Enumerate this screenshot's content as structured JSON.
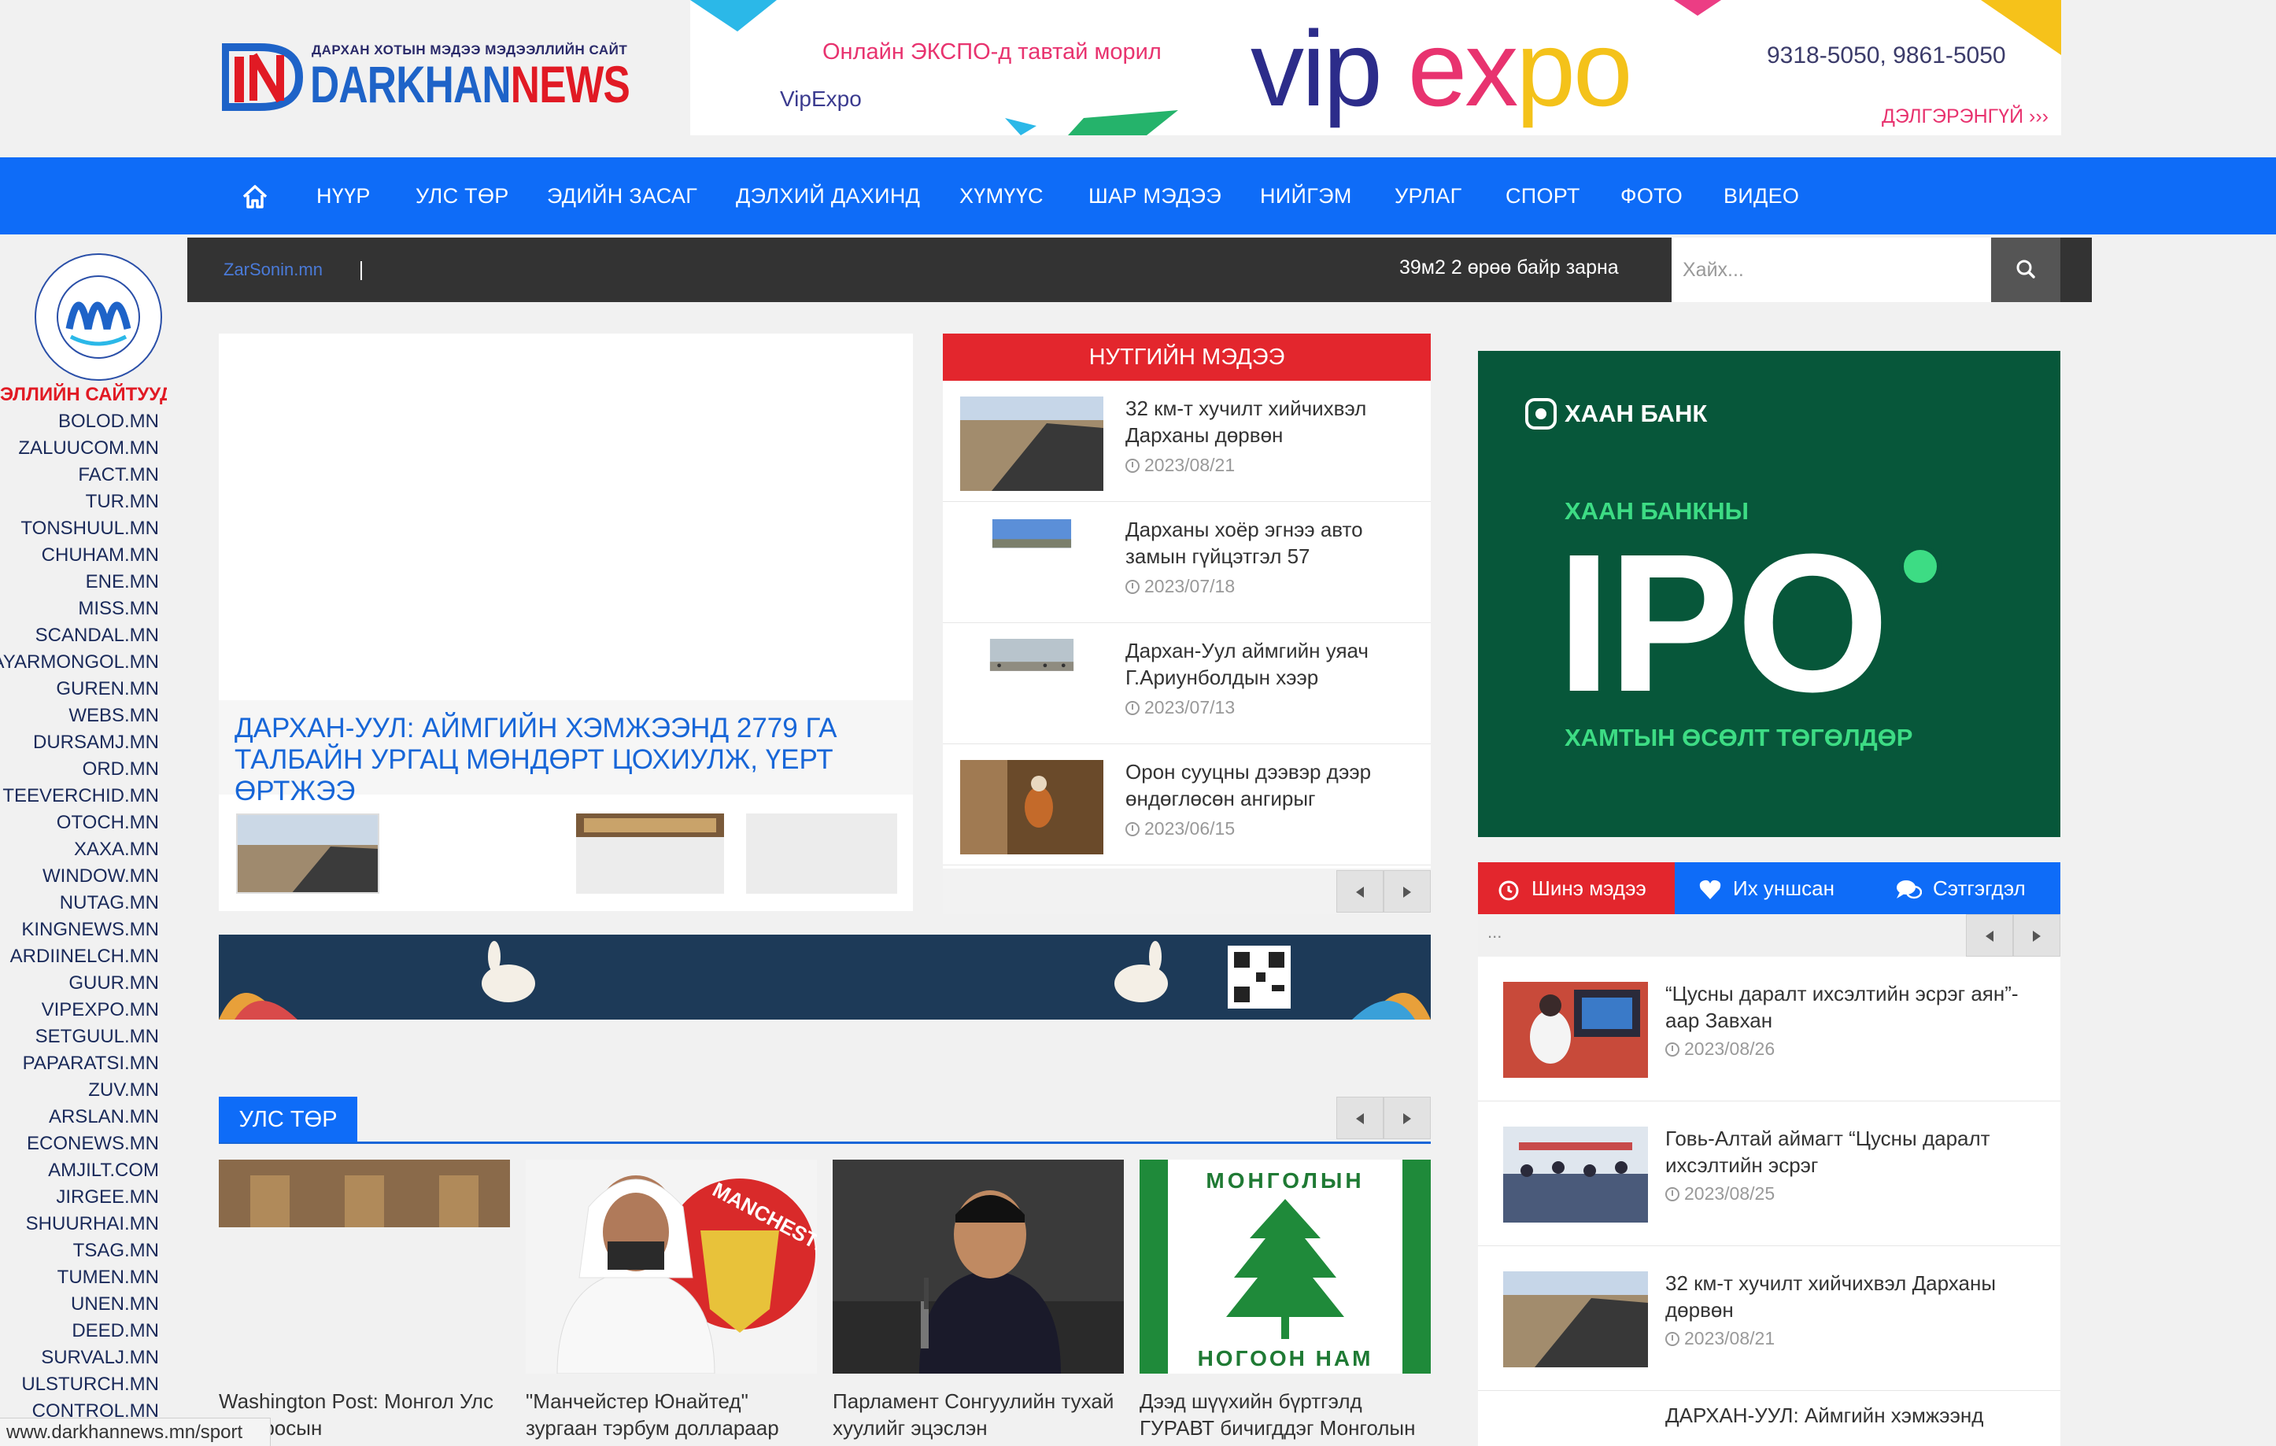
{
  "logo": {
    "tagline": "ДАРХАН ХОТЫН МЭДЭЭ МЭДЭЭЛЛИЙН САЙТ",
    "name_part1": "DARKHAN",
    "name_part2": "NEWS"
  },
  "top_ad": {
    "headline": "Онлайн ЭКСПО-д тавтай морил",
    "brand": "VipExpo",
    "logo_vip": "vip",
    "logo_ex": "ex",
    "logo_po": "po",
    "phones": "9318-5050, 9861-5050",
    "more": "ДЭЛГЭРЭНГҮЙ ›››"
  },
  "nav": {
    "items": [
      "НҮҮР",
      "УЛС ТӨР",
      "ЭДИЙН ЗАСАГ",
      "ДЭЛХИЙ ДАХИНД",
      "ХҮМҮҮС",
      "ШАР МЭДЭЭ",
      "НИЙГЭМ",
      "УРЛАГ",
      "СПОРТ",
      "ФОТО",
      "ВИДЕО"
    ]
  },
  "sidebar": {
    "heading": "ЭЛЛИЙН САЙТУУД",
    "sites": [
      "BOLOD.MN",
      "ZALUUCOM.MN",
      "FACT.MN",
      "TUR.MN",
      "TONSHUUL.MN",
      "CHUHAM.MN",
      "ENE.MN",
      "MISS.MN",
      "SCANDAL.MN",
      "BAYARMONGOL.MN",
      "GUREN.MN",
      "WEBS.MN",
      "DURSAMJ.MN",
      "ORD.MN",
      "TEEVERCHID.MN",
      "OTOCH.MN",
      "XAXA.MN",
      "WINDOW.MN",
      "NUTAG.MN",
      "KINGNEWS.MN",
      "ARDIINELCH.MN",
      "GUUR.MN",
      "VIPEXPO.MN",
      "SETGUUL.MN",
      "PAPARATSI.MN",
      "ZUV.MN",
      "ARSLAN.MN",
      "ECONEWS.MN",
      "AMJILT.COM",
      "JIRGEE.MN",
      "SHUURHAI.MN",
      "TSAG.MN",
      "TUMEN.MN",
      "UNEN.MN",
      "DEED.MN",
      "SURVALJ.MN",
      "ULSTURCH.MN",
      "CONTROL.MN"
    ]
  },
  "ticker": {
    "brand": "ZarSonin.mn",
    "text": "39м2 2 өрөө байр зарна"
  },
  "search": {
    "placeholder": "Хайх..."
  },
  "featured": {
    "caption": "ДАРХАН-УУЛ: АЙМГИЙН ХЭМЖЭЭНД 2779 ГА ТАЛБАЙН УРГАЦ МӨНДӨРТ ЦОХИУЛЖ, ҮЕРТ ӨРТЖЭЭ"
  },
  "local_news": {
    "title": "НУТГИЙН МЭДЭЭ",
    "items": [
      {
        "title": "32 км-т хучилт хийчихвэл Дарханы дөрвөн",
        "date": "2023/08/21"
      },
      {
        "title": "Дарханы хоёр эгнээ авто замын гүйцэтгэл 57",
        "date": "2023/07/18"
      },
      {
        "title": "Дархан-Уул аймгийн уяач Г.Ариунболдын хээр",
        "date": "2023/07/13"
      },
      {
        "title": "Орон сууцны дээвэр дээр өндөглөсөн ангирыг",
        "date": "2023/06/15"
      }
    ]
  },
  "politics": {
    "label": "УЛС ТӨР",
    "items": [
      {
        "title": "Washington Post: Монгол Улс ..., Оросын"
      },
      {
        "title": "\"Манчейстер Юнайтед\" зургаан тэрбум доллараар"
      },
      {
        "title": "Парламент Сонгуулийн тухай хуулийг эцэслэн"
      },
      {
        "title": "Дээд шүүхийн бүртгэлд ГУРАВТ бичигддэг Монголын"
      }
    ],
    "party_logo_top": "МОНГОЛЫН",
    "party_logo_bottom": "НОГООН НАМ",
    "club_text": "MANCHESTER"
  },
  "right_ad": {
    "bank": "ХААН БАНК",
    "subtitle": "ХААН БАНКНЫ",
    "ipo": "IPO",
    "slogan": "ХАМТЫН ӨСӨЛТ ТӨГӨЛДӨР"
  },
  "tabs": {
    "items": [
      "Шинэ мэдээ",
      "Их уншсан",
      "Сэтгэгдэл"
    ],
    "dots": "..."
  },
  "recent": {
    "items": [
      {
        "title": "“Цусны даралт ихсэлтийн эсрэг аян”-аар Завхан",
        "date": "2023/08/26"
      },
      {
        "title": "Говь-Алтай аймагт “Цусны даралт ихсэлтийн эсрэг",
        "date": "2023/08/25"
      },
      {
        "title": "32 км-т хучилт хийчихвэл Дарханы дөрвөн",
        "date": "2023/08/21"
      },
      {
        "title": "ДАРХАН-УУЛ: Аймгийн хэмжээнд",
        "date": ""
      }
    ]
  },
  "status_url": "www.darkhannews.mn/sport",
  "colors": {
    "nav_blue": "#0e6cf8",
    "local_red": "#e3262d",
    "khan_green": "#07573a",
    "link_blue": "#1766d8"
  }
}
